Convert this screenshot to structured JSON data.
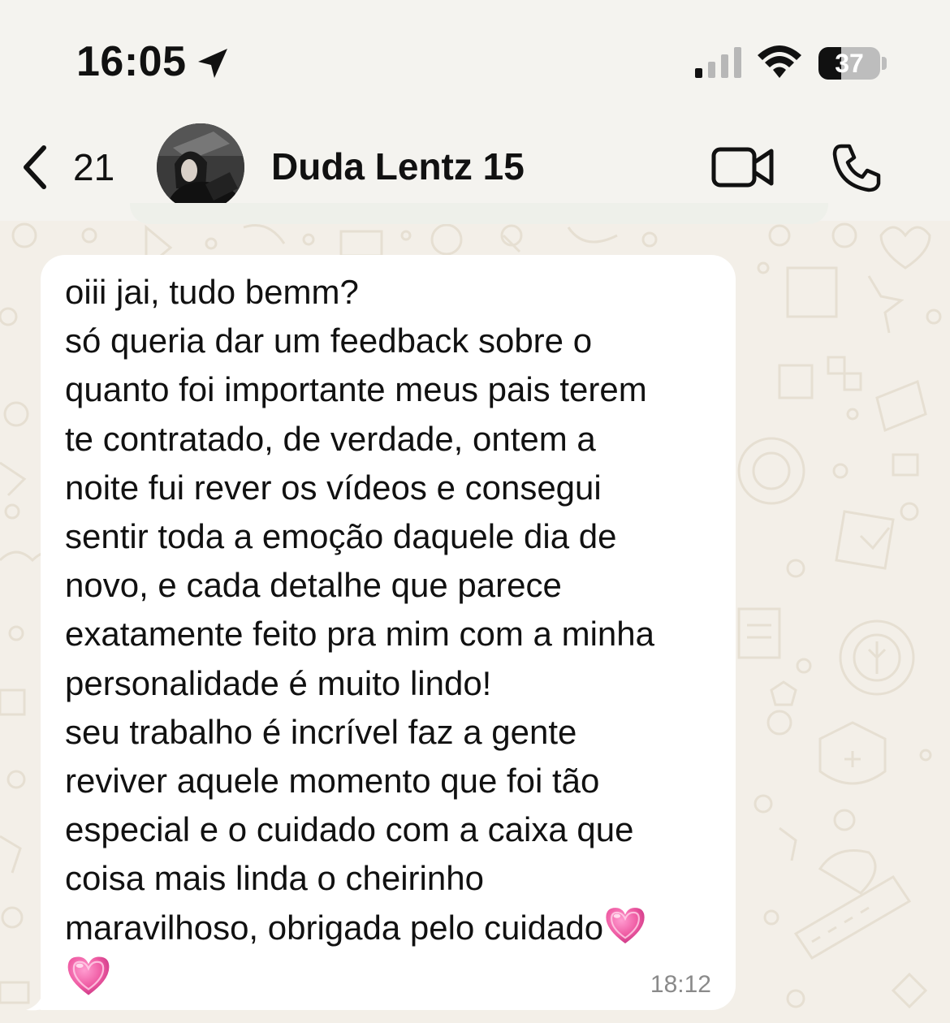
{
  "status_bar": {
    "time": "16:05",
    "battery_level": "37",
    "battery_fraction": 0.37,
    "icons": [
      "location-arrow-icon",
      "cellular-signal-icon",
      "wifi-icon",
      "battery-icon"
    ]
  },
  "header": {
    "back_count": "21",
    "contact_name": "Duda Lentz 15",
    "icons": [
      "chevron-left-icon",
      "video-camera-icon",
      "phone-icon"
    ]
  },
  "message": {
    "lines": [
      "oiii jai, tudo bemm?",
      "só queria dar um feedback sobre o",
      "quanto foi importante meus pais terem",
      "te contratado, de verdade, ontem a",
      "noite fui rever os vídeos e consegui",
      "sentir toda a emoção daquele dia de",
      "novo, e cada detalhe que parece",
      "exatamente feito pra mim com a minha",
      "personalidade é muito lindo!",
      "seu trabalho é incrível faz a gente",
      "reviver aquele momento que foi tão",
      "especial e o cuidado com a caixa que",
      "coisa mais linda o cheirinho",
      "maravilhoso, obrigada pelo cuidado"
    ],
    "emoji": "heart-emoji-icon",
    "time": "18:12"
  },
  "colors": {
    "header_bg": "#f4f3ef",
    "chat_bg": "#f3efe8",
    "bubble": "#ffffff",
    "heart": "#e8559a"
  }
}
